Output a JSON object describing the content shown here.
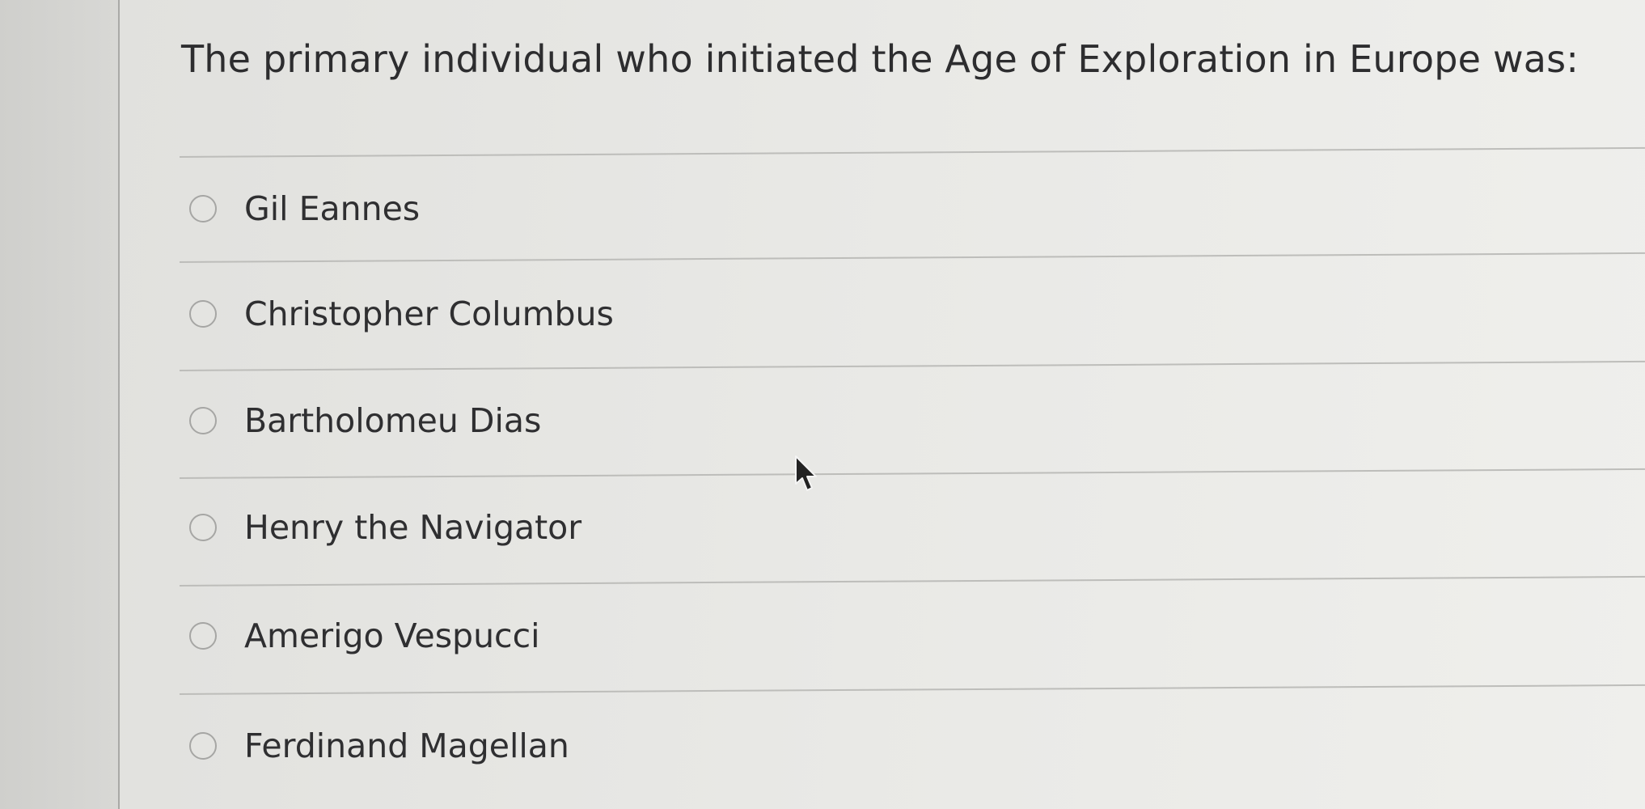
{
  "question": {
    "text": "The primary individual who initiated the Age of Exploration in Europe was:"
  },
  "options": [
    {
      "label": "Gil Eannes",
      "selected": false
    },
    {
      "label": "Christopher Columbus",
      "selected": false
    },
    {
      "label": "Bartholomeu Dias",
      "selected": false
    },
    {
      "label": "Henry the Navigator",
      "selected": false
    },
    {
      "label": "Amerigo Vespucci",
      "selected": false
    },
    {
      "label": "Ferdinand Magellan",
      "selected": false
    }
  ],
  "icons": {
    "radio": "radio-button-icon",
    "cursor": "mouse-pointer-icon"
  },
  "colors": {
    "text": "#2d2d2f",
    "divider": "#bdbdba",
    "radio_border": "#a6a6a4",
    "background": "#e9e9e6"
  }
}
